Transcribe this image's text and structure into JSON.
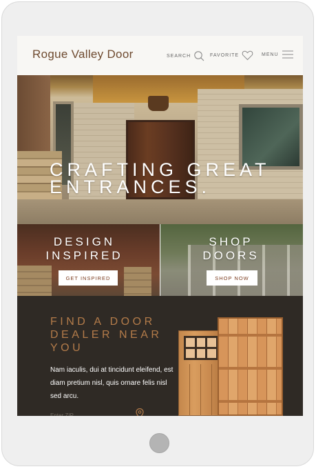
{
  "header": {
    "logo": "Rogue Valley Door",
    "nav": {
      "search_label": "SEARCH",
      "favorite_label": "FAVORITE",
      "menu_label": "MENU"
    }
  },
  "hero": {
    "title_line1": "CRAFTING GREAT",
    "title_line2": "ENTRANCES."
  },
  "promos": [
    {
      "title_line1": "DESIGN",
      "title_line2": "INSPIRED",
      "button": "GET INSPIRED"
    },
    {
      "title_line1": "SHOP",
      "title_line2": "DOORS",
      "button": "SHOP NOW"
    }
  ],
  "dealer": {
    "title_line1": "FIND A DOOR",
    "title_line2": "DEALER NEAR",
    "title_line3": "YOU",
    "text": "Nam iaculis, dui at tincidunt eleifend, est diam pretium nisl, quis ornare felis nisl sed arcu.",
    "zip_placeholder": "Enter ZIP"
  },
  "colors": {
    "brand": "#6e4a2f",
    "accent": "#b47c4a",
    "dealer_bg": "#2f2a25",
    "button_text": "#7a3a1c"
  },
  "icons": [
    "search-icon",
    "heart-icon",
    "hamburger-menu-icon",
    "location-pin-icon",
    "home-button"
  ]
}
